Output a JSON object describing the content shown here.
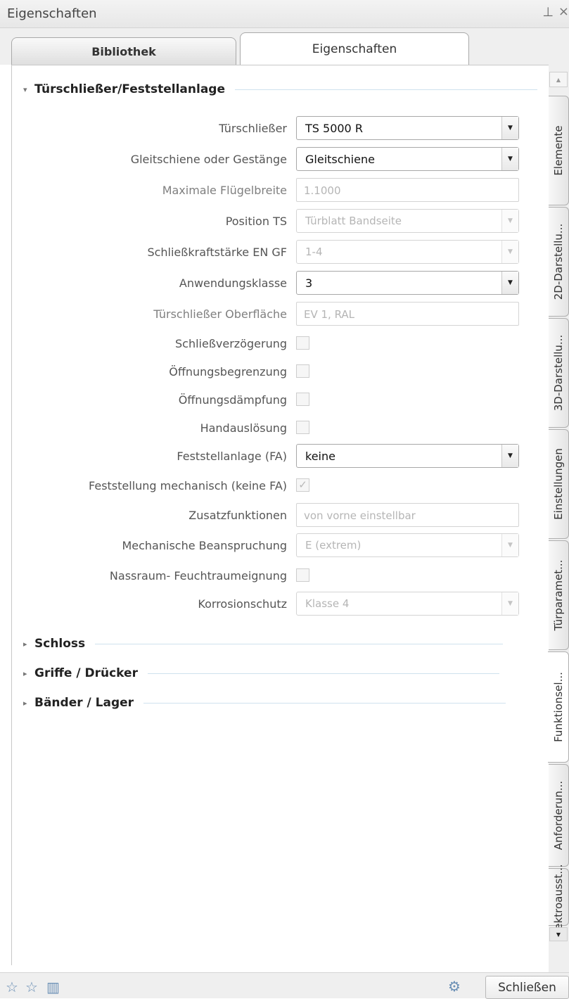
{
  "window": {
    "title": "Eigenschaften",
    "pin_icon": "pin-icon",
    "close_icon": "close-icon"
  },
  "tabs": [
    {
      "label": "Bibliothek",
      "active": false
    },
    {
      "label": "Eigenschaften",
      "active": true
    }
  ],
  "sections": [
    {
      "label": "Türschließer/Feststellanlage",
      "expanded": true
    },
    {
      "label": "Schloss",
      "expanded": false
    },
    {
      "label": "Griffe / Drücker",
      "expanded": false
    },
    {
      "label": "Bänder / Lager",
      "expanded": false
    }
  ],
  "fields": [
    {
      "label": "Türschließer",
      "type": "combo",
      "value": "TS 5000 R",
      "enabled": true
    },
    {
      "label": "Gleitschiene oder Gestänge",
      "type": "combo",
      "value": "Gleitschiene",
      "enabled": true
    },
    {
      "label": "Maximale Flügelbreite",
      "type": "text",
      "value": "1.1000",
      "enabled": false
    },
    {
      "label": "Position TS",
      "type": "combo",
      "value": "Türblatt Bandseite",
      "enabled": false
    },
    {
      "label": "Schließkraftstärke EN GF",
      "type": "combo",
      "value": "1-4",
      "enabled": false
    },
    {
      "label": "Anwendungsklasse",
      "type": "combo",
      "value": "3",
      "enabled": true
    },
    {
      "label": "Türschließer Oberfläche",
      "type": "text",
      "value": "EV 1, RAL",
      "enabled": false
    },
    {
      "label": "Schließverzögerung",
      "type": "checkbox",
      "checked": false
    },
    {
      "label": "Öffnungsbegrenzung",
      "type": "checkbox",
      "checked": false
    },
    {
      "label": "Öffnungsdämpfung",
      "type": "checkbox",
      "checked": false
    },
    {
      "label": "Handauslösung",
      "type": "checkbox",
      "checked": false
    },
    {
      "label": "Feststellanlage (FA)",
      "type": "combo",
      "value": "keine",
      "enabled": true
    },
    {
      "label": "Feststellung mechanisch (keine FA)",
      "type": "checkbox",
      "checked": true
    },
    {
      "label": "Zusatzfunktionen",
      "type": "text",
      "value": "von vorne einstellbar",
      "enabled": false
    },
    {
      "label": "Mechanische Beanspruchung",
      "type": "combo",
      "value": "E (extrem)",
      "enabled": false
    },
    {
      "label": "Nassraum- Feuchtraumeignung",
      "type": "checkbox",
      "checked": false
    },
    {
      "label": "Korrosionschutz",
      "type": "combo",
      "value": "Klasse 4",
      "enabled": false
    }
  ],
  "side_tabs": [
    {
      "label": "Elemente",
      "active": false
    },
    {
      "label": "2D-Darstellu...",
      "active": false
    },
    {
      "label": "3D-Darstellu...",
      "active": false
    },
    {
      "label": "Einstellungen",
      "active": false
    },
    {
      "label": "Türparamet...",
      "active": false
    },
    {
      "label": "Funktionsel...",
      "active": true
    },
    {
      "label": "Anforderun...",
      "active": false
    },
    {
      "label": "ektroausst...",
      "active": false
    }
  ],
  "footer": {
    "close_label": "Schließen"
  },
  "colors": {
    "section_line": "#cfe2ee",
    "icon_blue": "#6a8fb5"
  }
}
